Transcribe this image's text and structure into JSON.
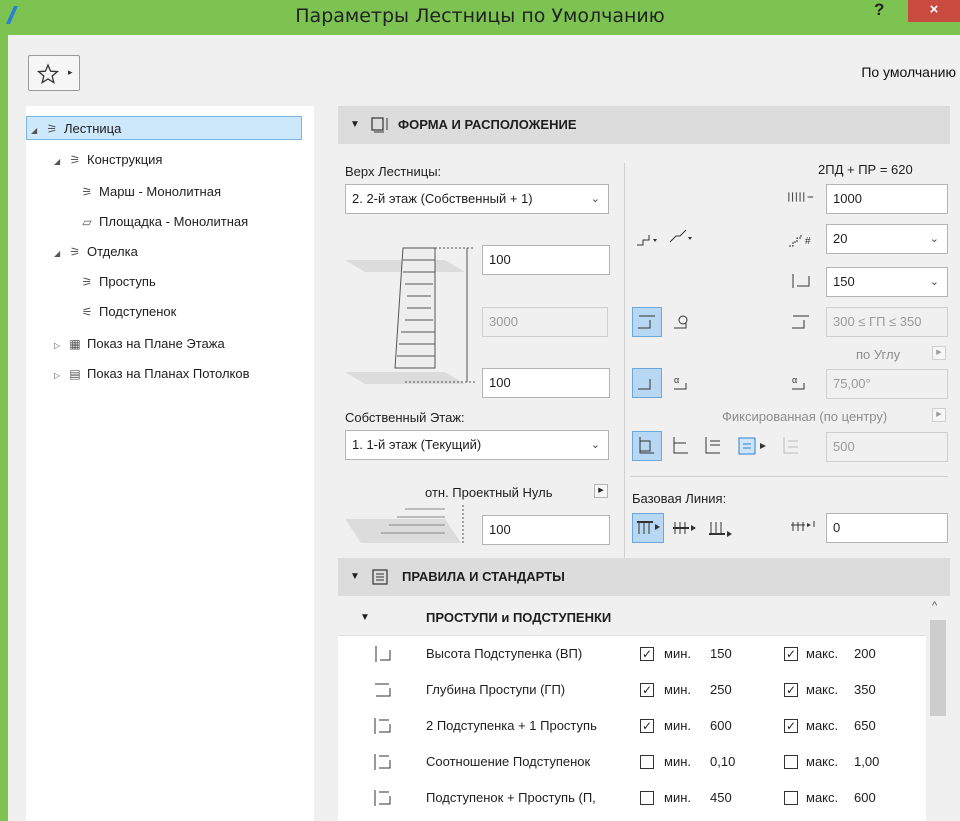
{
  "window": {
    "title": "Параметры Лестницы по Умолчанию",
    "help": "?",
    "close": "×"
  },
  "toolbar": {
    "favorites_arrow": "▸",
    "default_label": "По умолчанию"
  },
  "tree": {
    "items": [
      {
        "label": "Лестница",
        "toggle": "◢",
        "icon": "stair-icon"
      },
      {
        "label": "Конструкция",
        "toggle": "◢",
        "icon": "structure-icon"
      },
      {
        "label": "Марш - Монолитная",
        "toggle": "",
        "icon": "flight-icon"
      },
      {
        "label": "Площадка - Монолитная",
        "toggle": "",
        "icon": "landing-icon"
      },
      {
        "label": "Отделка",
        "toggle": "◢",
        "icon": "finish-icon"
      },
      {
        "label": "Проступь",
        "toggle": "",
        "icon": "tread-icon"
      },
      {
        "label": "Подступенок",
        "toggle": "",
        "icon": "riser-icon"
      },
      {
        "label": "Показ на Плане Этажа",
        "toggle": "▷",
        "icon": "floor-plan-icon"
      },
      {
        "label": "Показ на Планах Потолков",
        "toggle": "▷",
        "icon": "ceiling-plan-icon"
      }
    ]
  },
  "section1": {
    "arrow": "▼",
    "title": "ФОРМА И РАСПОЛОЖЕНИЕ",
    "top_label": "Верх Лестницы:",
    "top_value": "2. 2-й этаж (Собственный + 1)",
    "top_offset": "100",
    "height": "3000",
    "bottom_offset": "100",
    "home_story_label": "Собственный Этаж:",
    "home_story_value": "1. 1-й этаж (Текущий)",
    "ref_label": "отн. Проектный Нуль",
    "ref_value": "100",
    "formula": "2ПД + ПР = 620",
    "width_value": "1000",
    "risers_value": "20",
    "riser_height_value": "150",
    "tread_range": "300 ≤ ГП ≤ 350",
    "by_angle_label": "по Углу",
    "angle_value": "75,00°",
    "fixed_label": "Фиксированная (по центру)",
    "fixed_value": "500",
    "baseline_label": "Базовая Линия:",
    "baseline_offset": "0",
    "menu_arrow": "▶"
  },
  "section2": {
    "arrow": "▼",
    "title": "ПРАВИЛА И СТАНДАРТЫ",
    "sub_arrow": "▼",
    "sub_title": "ПРОСТУПИ и ПОДСТУПЕНКИ",
    "scroll_up": "^",
    "min_label": "мин.",
    "max_label": "макс.",
    "rows": [
      {
        "name": "Высота Подступенка (ВП)",
        "min_checked": true,
        "min": "150",
        "max_checked": true,
        "max": "200",
        "icon": "riser-height-icon"
      },
      {
        "name": "Глубина Проступи (ГП)",
        "min_checked": true,
        "min": "250",
        "max_checked": true,
        "max": "350",
        "icon": "tread-depth-icon"
      },
      {
        "name": "2 Подступенка + 1 Проступь",
        "min_checked": true,
        "min": "600",
        "max_checked": true,
        "max": "650",
        "icon": "two-risers-icon"
      },
      {
        "name": "Соотношение Подступенок",
        "min_checked": false,
        "min": "0,10",
        "max_checked": false,
        "max": "1,00",
        "icon": "ratio-icon"
      },
      {
        "name": "Подступенок + Проступь (П,",
        "min_checked": false,
        "min": "450",
        "max_checked": false,
        "max": "600",
        "icon": "sum-icon"
      }
    ]
  }
}
